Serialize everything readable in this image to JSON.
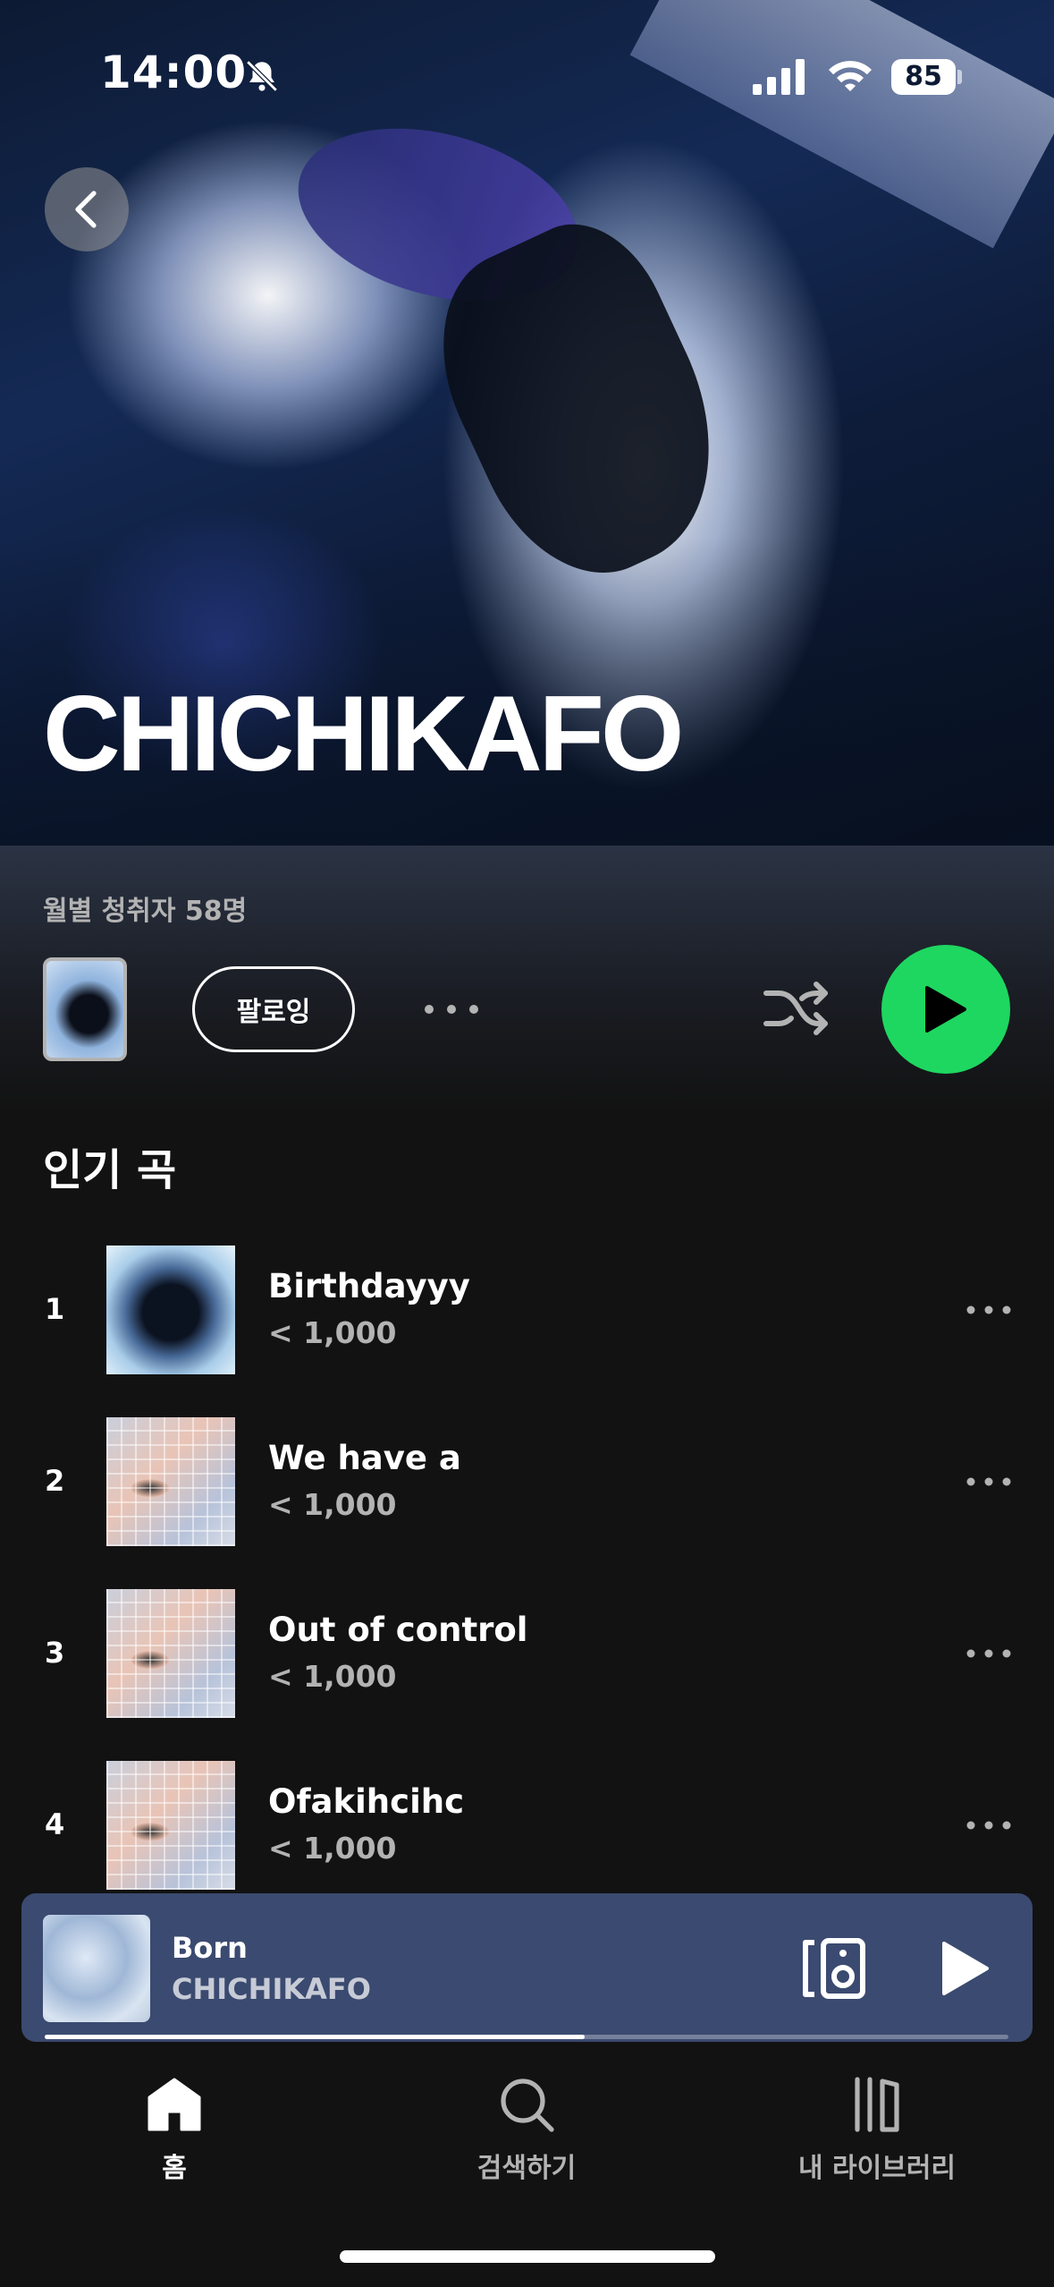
{
  "status_bar": {
    "time": "14:00",
    "battery": "85",
    "icons": [
      "bell-slash-icon",
      "signal-icon",
      "wifi-icon",
      "battery-icon"
    ]
  },
  "header": {
    "artist_name": "CHICHIKAFO",
    "back_icon": "chevron-left-icon"
  },
  "artist_info": {
    "monthly_listeners": "월별 청취자 58명",
    "follow_label": "팔로잉"
  },
  "popular": {
    "title": "인기 곡",
    "tracks": [
      {
        "rank": "1",
        "title": "Birthdayyy",
        "plays": "< 1,000"
      },
      {
        "rank": "2",
        "title": "We have a",
        "plays": "< 1,000"
      },
      {
        "rank": "3",
        "title": "Out of control",
        "plays": "< 1,000"
      },
      {
        "rank": "4",
        "title": "Ofakihcihc",
        "plays": "< 1,000"
      }
    ]
  },
  "now_playing": {
    "title": "Born",
    "artist": "CHICHIKAFO",
    "progress": 0.56
  },
  "nav": {
    "home": "홈",
    "search": "검색하기",
    "library": "내 라이브러리"
  },
  "colors": {
    "accent": "#1ed760",
    "background": "#121212",
    "mini_player": "#3b4a70",
    "secondary_text": "#b3b3b3"
  }
}
